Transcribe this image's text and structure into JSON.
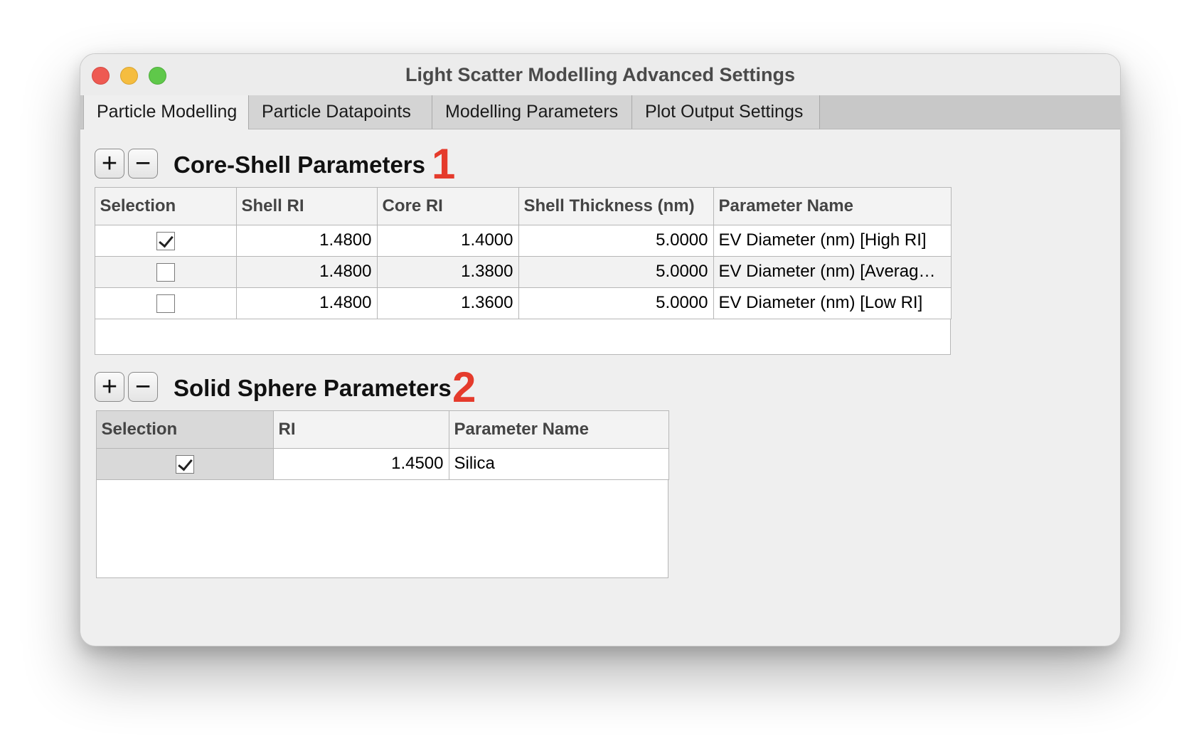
{
  "window": {
    "title": "Light Scatter Modelling Advanced Settings"
  },
  "tabs": [
    {
      "label": "Particle Modelling",
      "active": true
    },
    {
      "label": "Particle Datapoints",
      "active": false
    },
    {
      "label": "Modelling Parameters",
      "active": false
    },
    {
      "label": "Plot Output Settings",
      "active": false
    }
  ],
  "buttons": {
    "add": "+",
    "remove": "−"
  },
  "core_shell": {
    "title": "Core-Shell Parameters",
    "badge": "1",
    "columns": [
      "Selection",
      "Shell RI",
      "Core RI",
      "Shell Thickness (nm)",
      "Parameter Name"
    ],
    "rows": [
      {
        "selected": true,
        "shell_ri": "1.4800",
        "core_ri": "1.4000",
        "thickness": "5.0000",
        "name": "EV Diameter (nm) [High RI]"
      },
      {
        "selected": false,
        "shell_ri": "1.4800",
        "core_ri": "1.3800",
        "thickness": "5.0000",
        "name": "EV Diameter (nm) [Averag…"
      },
      {
        "selected": false,
        "shell_ri": "1.4800",
        "core_ri": "1.3600",
        "thickness": "5.0000",
        "name": "EV Diameter (nm) [Low RI]"
      }
    ]
  },
  "solid_sphere": {
    "title": "Solid Sphere Parameters",
    "badge": "2",
    "columns": [
      "Selection",
      "RI",
      "Parameter Name"
    ],
    "rows": [
      {
        "selected": true,
        "ri": "1.4500",
        "name": "Silica"
      }
    ]
  },
  "icons": {
    "close": "close-icon",
    "minimize": "minimize-icon",
    "zoom": "zoom-icon",
    "checkmark": "checkmark-icon"
  }
}
